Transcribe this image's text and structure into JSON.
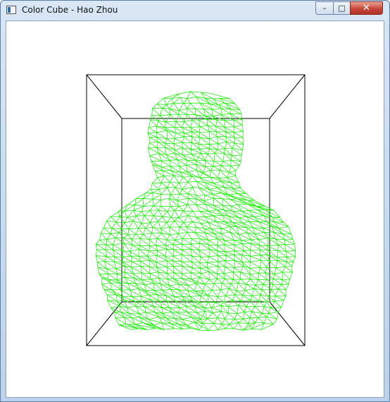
{
  "window": {
    "title": "Color Cube - Hao Zhou",
    "minimize_glyph": "–",
    "maximize_glyph": "□",
    "close_glyph": "✕",
    "app_icon": "window-app-icon"
  },
  "scene": {
    "background": "#ffffff",
    "box_color": "#000000",
    "mesh_color": "#22ee11"
  }
}
